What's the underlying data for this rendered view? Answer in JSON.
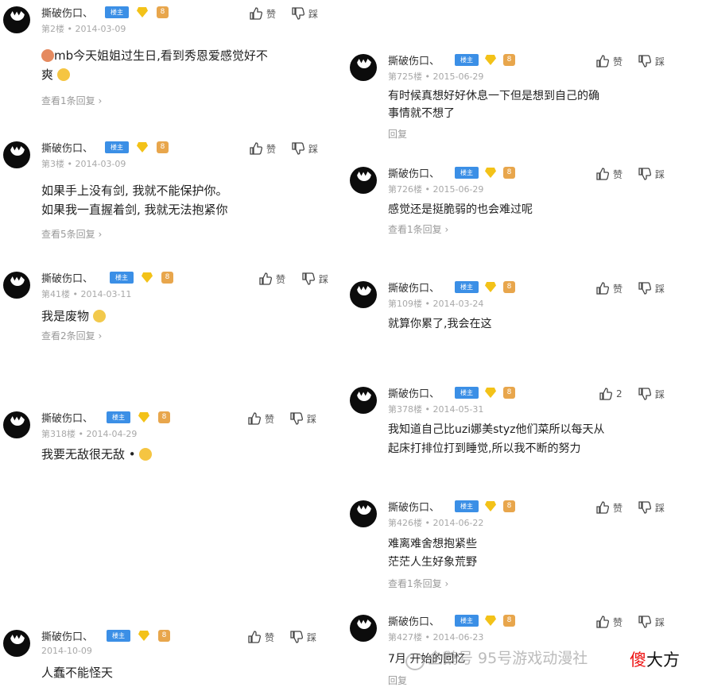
{
  "common": {
    "username": "撕破伤口、",
    "host_badge": "楼主",
    "level_badge": "8",
    "like_label": "赞",
    "dislike_label": "踩"
  },
  "left": [
    {
      "meta": "第2楼 • 2014-03-09",
      "text": [
        "mb今天姐姐过生日,看到秀恩爱感觉好不",
        "爽"
      ],
      "reply": "查看1条回复 ›"
    },
    {
      "meta": "第3楼 • 2014-03-09",
      "text": [
        "如果手上没有剑, 我就不能保护你。",
        "如果我一直握着剑, 我就无法抱紧你"
      ],
      "reply": "查看5条回复 ›"
    },
    {
      "meta": "第41楼 • 2014-03-11",
      "text": [
        "我是废物"
      ],
      "reply": "查看2条回复 ›"
    },
    {
      "meta": "第318楼 • 2014-04-29",
      "text": [
        "我要无敌很无敌 •"
      ],
      "reply": ""
    },
    {
      "meta": "2014-10-09",
      "text": [
        "人蠢不能怪天"
      ],
      "reply": ""
    }
  ],
  "right": [
    {
      "meta": "第725楼 • 2015-06-29",
      "text": [
        "有时候真想好好休息一下但是想到自己的确",
        "事情就不想了"
      ],
      "reply": "回复"
    },
    {
      "meta": "第726楼 • 2015-06-29",
      "text": [
        "感觉还是挺脆弱的也会难过呢"
      ],
      "reply": "查看1条回复 ›"
    },
    {
      "meta": "第109楼 • 2014-03-24",
      "text": [
        "就算你累了,我会在这"
      ],
      "reply": ""
    },
    {
      "meta": "第378楼 • 2014-05-31",
      "text": [
        "我知道自己比uzi娜美styz他们菜所以每天从",
        "起床打排位打到睡觉,所以我不断的努力"
      ],
      "reply": "",
      "likes": "2"
    },
    {
      "meta": "第426楼 • 2014-06-22",
      "text": [
        "难离难舍想抱紧些",
        "茫茫人生好象荒野"
      ],
      "reply": "查看1条回复 ›"
    },
    {
      "meta": "第427楼 • 2014-06-23",
      "text": [
        "7月    开始的回忆"
      ],
      "reply": "回复"
    }
  ],
  "watermark": "企鹅号 95号游戏动漫社",
  "brand": {
    "red": "傻",
    "rest": "大方"
  }
}
